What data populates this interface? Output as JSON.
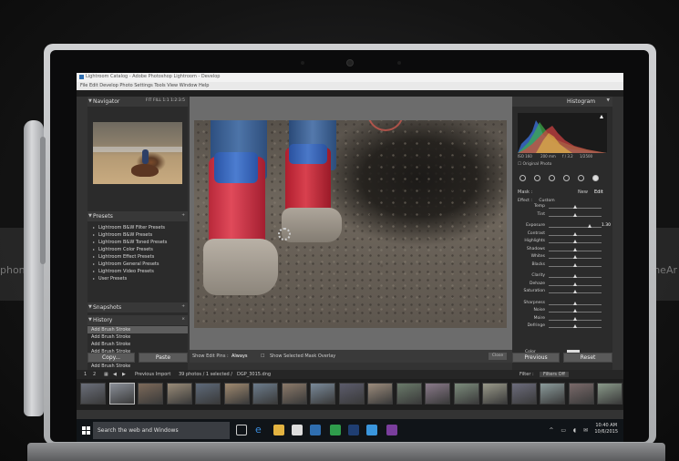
{
  "watermark": {
    "left": "phone",
    "right": "phoneAr"
  },
  "window": {
    "title": "Lightroom Catalog - Adobe Photoshop Lightroom - Develop",
    "menu": "File  Edit  Develop  Photo  Settings  Tools  View  Window  Help"
  },
  "navigator": {
    "title": "Navigator",
    "zoom_options": "FIT   FILL   1:1   1:2:3:5"
  },
  "presets": {
    "title": "Presets",
    "items": [
      "Lightroom B&W Filter Presets",
      "Lightroom B&W Presets",
      "Lightroom B&W Toned Presets",
      "Lightroom Color Presets",
      "Lightroom Effect Presets",
      "Lightroom General Presets",
      "Lightroom Video Presets",
      "User Presets"
    ]
  },
  "snapshots": {
    "title": "Snapshots"
  },
  "history": {
    "title": "History",
    "items": [
      "Add Brush Stroke",
      "Add Brush Stroke",
      "Add Brush Stroke",
      "Add Brush Stroke",
      "Add Brush Stroke",
      "Add Brush Stroke",
      "Add Brush Stroke",
      "Add Brush Stroke"
    ]
  },
  "left_buttons": {
    "copy": "Copy...",
    "paste": "Paste"
  },
  "center_toolbar": {
    "show_edit_pins_label": "Show Edit Pins :",
    "show_edit_pins_value": "Always",
    "mask_overlay": "Show Selected Mask Overlay",
    "close": "Close"
  },
  "histogram": {
    "title": "Histogram",
    "iso": "ISO 160",
    "focal": "200 mm",
    "aperture": "f / 3.2",
    "shutter": "1/2500",
    "original_photo": "Original Photo"
  },
  "mask": {
    "label": "Mask :",
    "new": "New",
    "edit": "Edit"
  },
  "effect": {
    "label": "Effect :",
    "value": "Custom"
  },
  "sliders": [
    {
      "label": "Temp",
      "value": 0.5
    },
    {
      "label": "Tint",
      "value": 0.5
    },
    {
      "label": "Exposure",
      "value": 0.78,
      "readout": "1.30"
    },
    {
      "label": "Contrast",
      "value": 0.5
    },
    {
      "label": "Highlights",
      "value": 0.5
    },
    {
      "label": "Shadows",
      "value": 0.5
    },
    {
      "label": "Whites",
      "value": 0.5
    },
    {
      "label": "Blacks",
      "value": 0.5
    },
    {
      "label": "Clarity",
      "value": 0.5
    },
    {
      "label": "Dehaze",
      "value": 0.5
    },
    {
      "label": "Saturation",
      "value": 0.5
    },
    {
      "label": "Sharpness",
      "value": 0.5
    },
    {
      "label": "Noise",
      "value": 0.5
    },
    {
      "label": "Moire",
      "value": 0.5
    },
    {
      "label": "Defringe",
      "value": 0.5
    }
  ],
  "color_label": "Color",
  "right_buttons": {
    "previous": "Previous",
    "reset": "Reset"
  },
  "filmbar": {
    "page1": "1",
    "page2": "2",
    "previous_import": "Previous Import",
    "count": "39 photos / 1 selected /",
    "filename": "DGP_3015.dng",
    "filter_label": "Filter :",
    "filter_value": "Filters Off"
  },
  "taskbar": {
    "search": "Search the web and Windows",
    "time": "10:40 AM",
    "date": "10/6/2015"
  },
  "colors": {
    "panel": "#2b2b2b",
    "panel_header": "#383838",
    "taskbar": "#101418",
    "accent_blue": "#2f6eb0"
  }
}
